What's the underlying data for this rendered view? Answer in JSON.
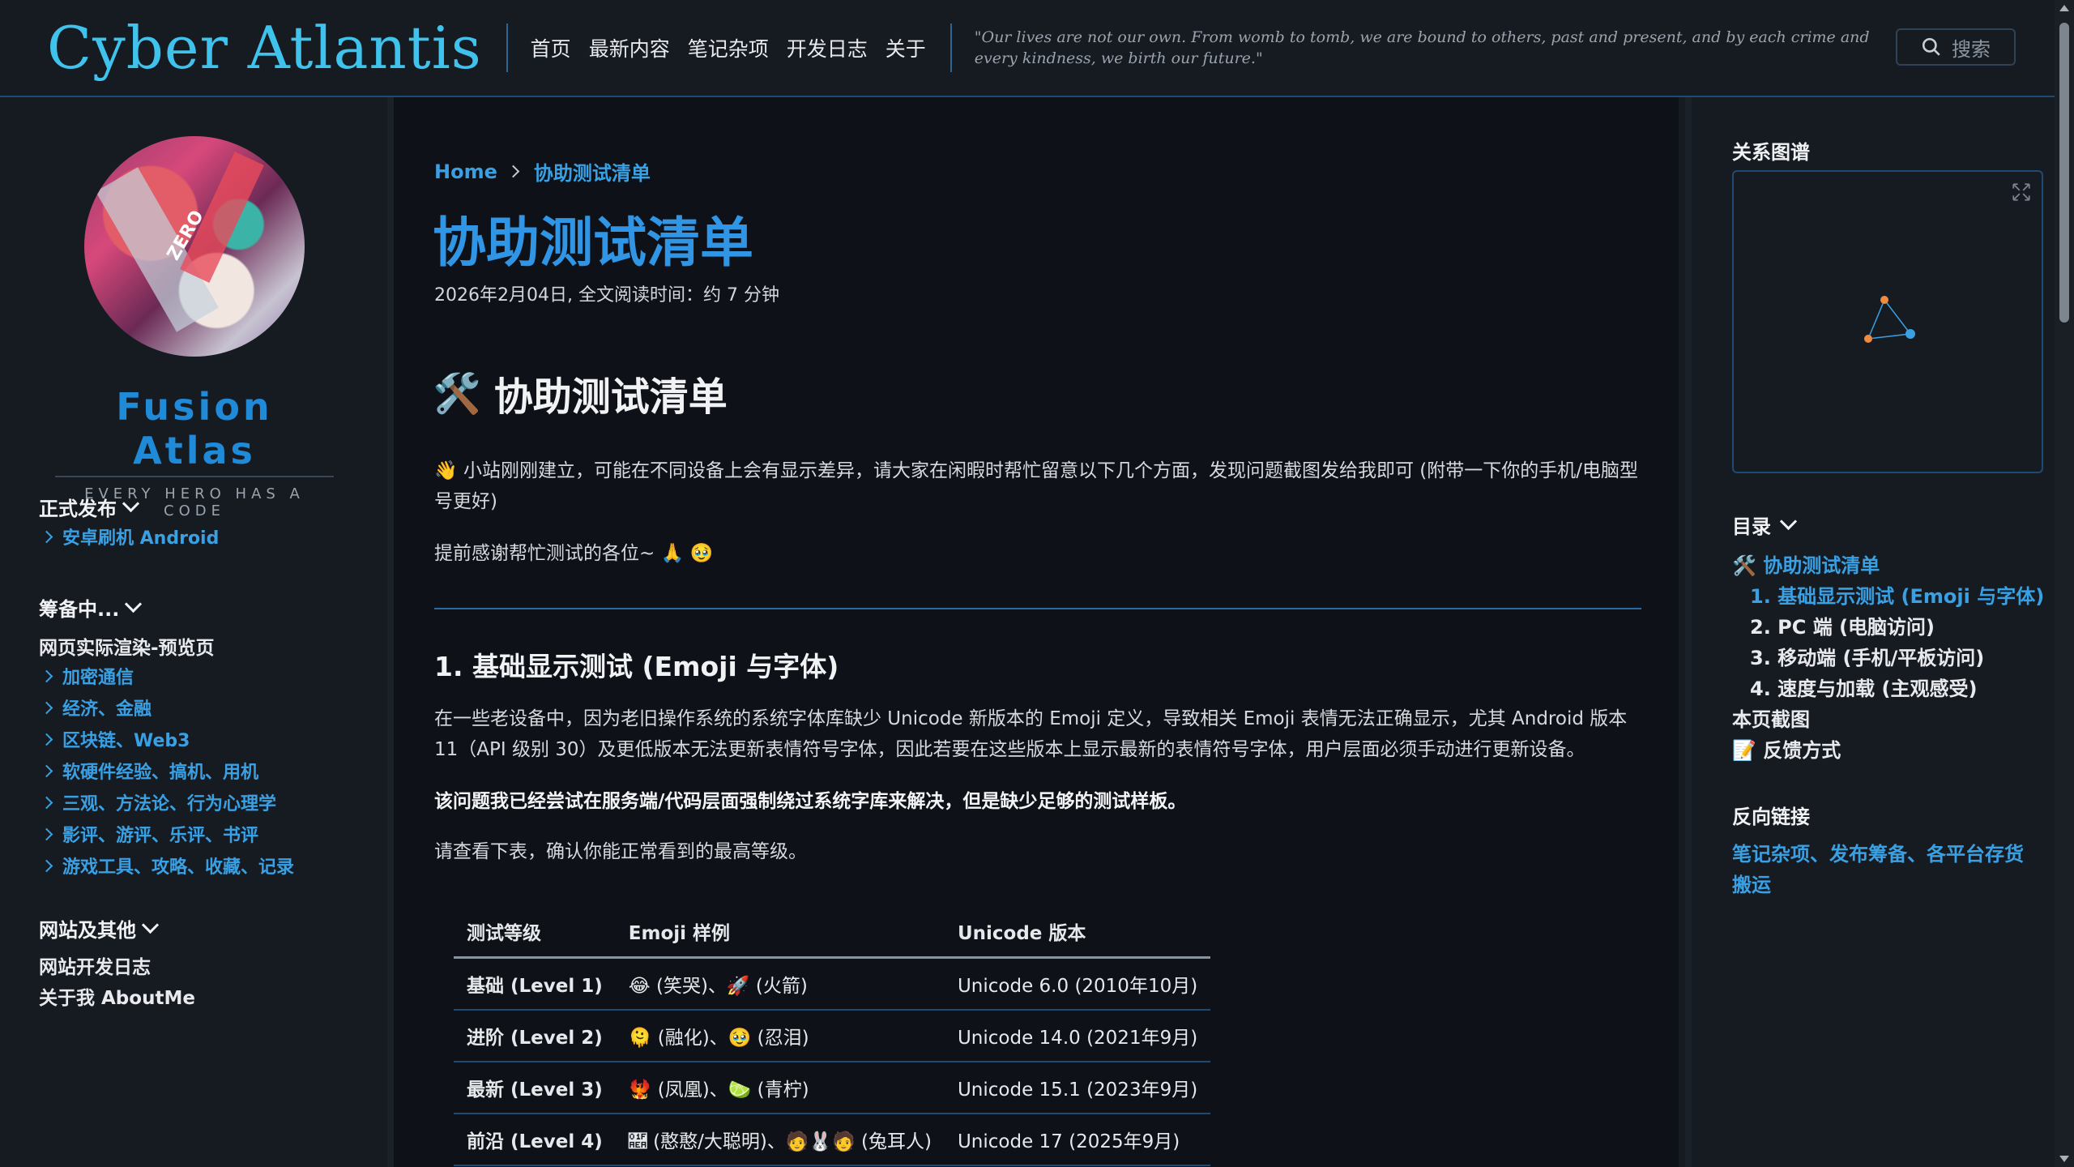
{
  "header": {
    "logo": "Cyber Atlantis",
    "nav": [
      "首页",
      "最新内容",
      "笔记杂项",
      "开发日志",
      "关于"
    ],
    "quote": "\"Our lives are not our own. From womb to tomb, we are bound to others, past and present, and by each crime and every kindness, we birth our future.\"",
    "search_label": "搜索"
  },
  "left_sidebar": {
    "brand_name": "Fusion Atlas",
    "brand_tagline": "EVERY HERO HAS A CODE",
    "avatar_text": "ZERO",
    "sections": [
      {
        "title": "正式发布",
        "items": [
          {
            "label": "安卓刷机 Android",
            "type": "link"
          }
        ]
      },
      {
        "title": "筹备中...",
        "items": [
          {
            "label": "网页实际渲染-预览页",
            "type": "plain"
          },
          {
            "label": "加密通信",
            "type": "link"
          },
          {
            "label": "经济、金融",
            "type": "link"
          },
          {
            "label": "区块链、Web3",
            "type": "link"
          },
          {
            "label": "软硬件经验、搞机、用机",
            "type": "link"
          },
          {
            "label": "三观、方法论、行为心理学",
            "type": "link"
          },
          {
            "label": "影评、游评、乐评、书评",
            "type": "link"
          },
          {
            "label": "游戏工具、攻略、收藏、记录",
            "type": "link"
          }
        ]
      },
      {
        "title": "网站及其他",
        "items": [
          {
            "label": "网站开发日志",
            "type": "plain"
          },
          {
            "label": "关于我 AboutMe",
            "type": "plain"
          }
        ]
      }
    ]
  },
  "main": {
    "breadcrumb": {
      "home": "Home",
      "current": "协助测试清单"
    },
    "page_title": "协助测试清单",
    "meta": "2026年2月04日, 全文阅读时间：约 7 分钟",
    "h1_icon": "🛠️",
    "h1": "协助测试清单",
    "intro_icon": "👋",
    "intro": "小站刚刚建立，可能在不同设备上会有显示差异，请大家在闲暇时帮忙留意以下几个方面，发现问题截图发给我即可 (附带一下你的手机/电脑型号更好)",
    "thanks": "提前感谢帮忙测试的各位~ 🙏 🥹",
    "h2": "1. 基础显示测试 (Emoji 与字体)",
    "para1": "在一些老设备中，因为老旧操作系统的系统字体库缺少 Unicode 新版本的 Emoji 定义，导致相关 Emoji 表情无法正确显示，尤其 Android 版本 11（API 级别 30）及更低版本无法更新表情符号字体，因此若要在这些版本上显示最新的表情符号字体，用户层面必须手动进行更新设备。",
    "para2": "该问题我已经尝试在服务端/代码层面强制绕过系统字库来解决，但是缺少足够的测试样板。",
    "para3": "请查看下表，确认你能正常看到的最高等级。",
    "table": {
      "headers": [
        "测试等级",
        "Emoji 样例",
        "Unicode 版本"
      ],
      "rows": [
        [
          "基础 (Level 1)",
          "😂 (笑哭)、🚀 (火箭)",
          "Unicode 6.0 (2010年10月)"
        ],
        [
          "进阶 (Level 2)",
          "🫠 (融化)、🥹 (忍泪)",
          "Unicode 14.0 (2021年9月)"
        ],
        [
          "最新 (Level 3)",
          "🐦‍🔥 (凤凰)、🍋‍🟩 (青柠)",
          "Unicode 15.1 (2023年9月)"
        ],
        [
          "前沿 (Level 4)",
          "🫪 (憨憨/大聪明)、🧑‍🐰‍🧑 (兔耳人)",
          "Unicode 17 (2025年9月)"
        ]
      ]
    }
  },
  "right_sidebar": {
    "graph_title": "关系图谱",
    "toc_title": "目录",
    "toc": [
      {
        "label": "🛠️ 协助测试清单",
        "level": 1,
        "active": true
      },
      {
        "label": "1. 基础显示测试 (Emoji 与字体)",
        "level": 2,
        "active": true
      },
      {
        "label": "2. PC 端 (电脑访问)",
        "level": 2,
        "active": false
      },
      {
        "label": "3. 移动端 (手机/平板访问)",
        "level": 2,
        "active": false
      },
      {
        "label": "4. 速度与加载 (主观感受)",
        "level": 2,
        "active": false
      },
      {
        "label": "本页截图",
        "level": 1,
        "active": false
      },
      {
        "label": "📝 反馈方式",
        "level": 1,
        "active": false
      }
    ],
    "backlinks_title": "反向链接",
    "backlinks": "笔记杂项、发布筹备、各平台存货搬运"
  },
  "colors": {
    "accent": "#3aa0e4",
    "logo": "#3fc3ec",
    "title": "#2f95e4",
    "background": "#0e1117",
    "panel": "#161b22"
  }
}
